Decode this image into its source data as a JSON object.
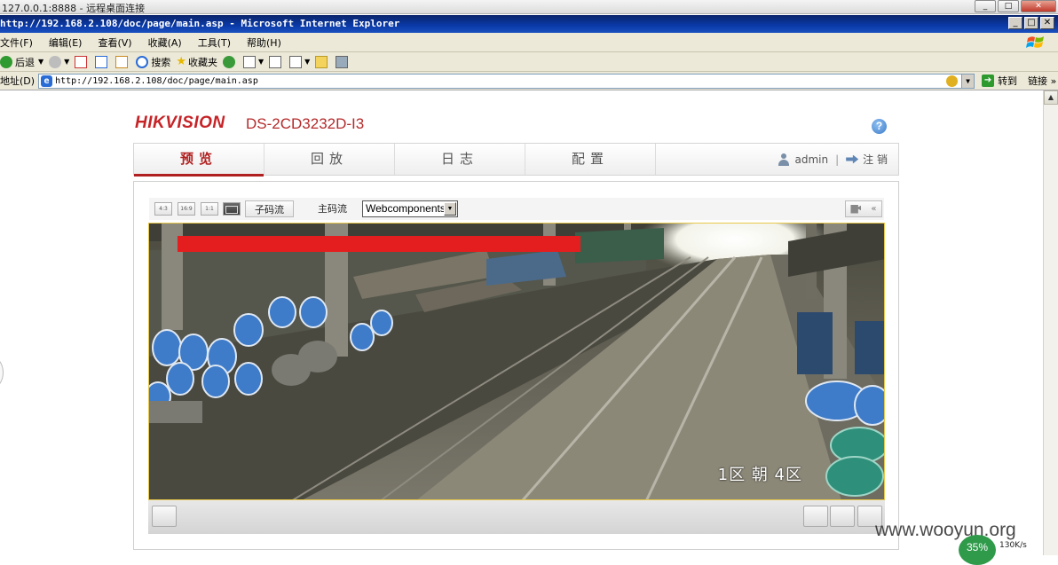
{
  "rdp": {
    "title": "127.0.0.1:8888 - 远程桌面连接",
    "buttons": [
      "_",
      "□",
      "✕"
    ]
  },
  "ie": {
    "title": "http://192.168.2.108/doc/page/main.asp - Microsoft Internet Explorer",
    "menu": [
      "文件(F)",
      "编辑(E)",
      "查看(V)",
      "收藏(A)",
      "工具(T)",
      "帮助(H)"
    ],
    "toolbar": {
      "back": "后退",
      "search": "搜索",
      "favorites": "收藏夹"
    },
    "address_label": "地址(D)",
    "address": "http://192.168.2.108/doc/page/main.asp",
    "go": "转到",
    "links": "链接",
    "chevron": "»"
  },
  "page": {
    "brand": "HIKVISION",
    "model": "DS-2CD3232D-I3",
    "help": "?",
    "nav": {
      "tabs": [
        "预览",
        "回放",
        "日志",
        "配置"
      ],
      "user": "admin",
      "separator": "|",
      "logout": "注 销"
    },
    "controls": {
      "ratios": [
        "4:3",
        "16:9",
        "1:1"
      ],
      "sub_stream": "子码流",
      "main_stream": "主码流",
      "plugin": "Webcomponents",
      "ptz_collapse": "«"
    },
    "osd_text": "1区 朝 4区"
  },
  "overlay": {
    "watermark": "www.wooyun.org",
    "net_percent": "35%",
    "net_speed": "130K/s"
  },
  "colors": {
    "brand_red": "#c62327",
    "ie_titlebar": "#0a246a",
    "active_tab": "#b02020"
  }
}
